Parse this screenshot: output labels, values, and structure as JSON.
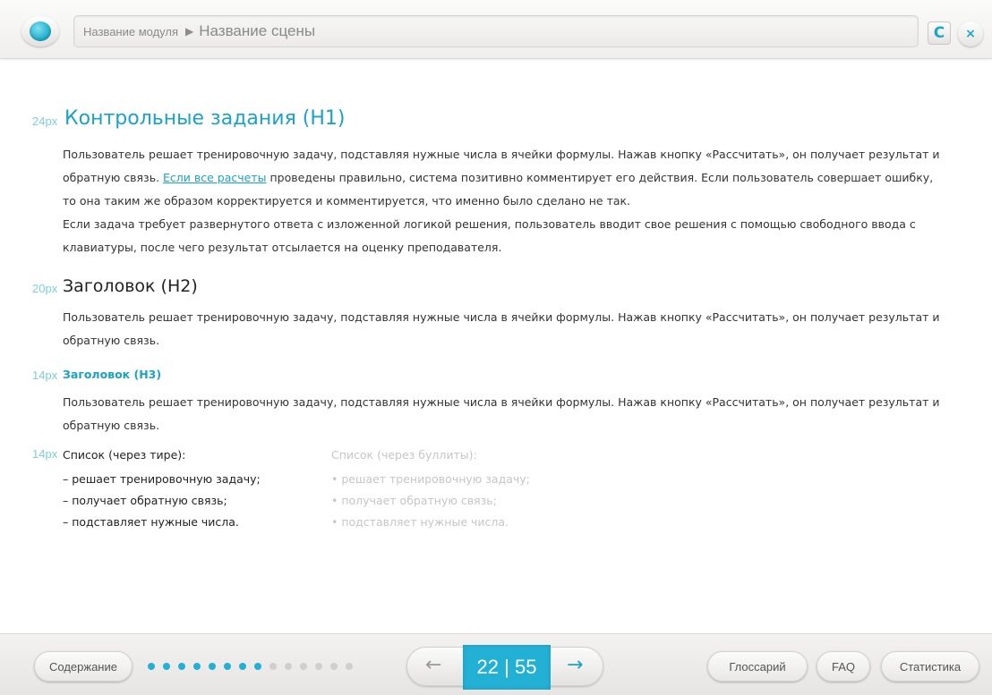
{
  "header": {
    "module_name": "Название модуля",
    "arrow": "▶",
    "scene_name": "Название сцены",
    "refresh_glyph": "C",
    "close_glyph": "×"
  },
  "content": {
    "h1": {
      "size": "24px",
      "text": "Контрольные задания (H1)"
    },
    "para1": {
      "before_link": "Пользователь решает тренировочную задачу, подставляя нужные числа в ячейки формулы. Нажав кнопку «Рассчитать», он получает результат и обратную связь. ",
      "link": "Если все расчеты",
      "after_link": " проведены правильно, система позитивно комментирует его действия. Если пользователь совершает ошибку, то она таким же образом корректируется и комментируется, что именно было сделано не так."
    },
    "para2": "Если задача требует развернутого ответа с изложенной логикой решения, пользователь вводит свое решения с помощью свободного ввода с клавиатуры, после чего результат отсылается на оценку преподавателя.",
    "h2": {
      "size": "20px",
      "text": "Заголовок (H2)"
    },
    "para3": "Пользователь решает тренировочную задачу, подставляя нужные числа в ячейки формулы. Нажав кнопку «Рассчитать», он получает результат и обратную связь.",
    "h3": {
      "size": "14px",
      "text": "Заголовок (H3)"
    },
    "para4": "Пользователь решает тренировочную задачу, подставляя нужные числа в ячейки формулы. Нажав кнопку «Рассчитать», он получает результат и обратную связь.",
    "list_size": "14px",
    "dash_list": {
      "title": "Список (через тире):",
      "items": [
        "– решает тренировочную задачу;",
        "– получает обратную связь;",
        "– подставляет нужные числа."
      ]
    },
    "bullet_list": {
      "title": "Список (через буллиты):",
      "items": [
        "• решает тренировочную задачу;",
        "• получает обратную связь;",
        "• подставляет нужные числа."
      ]
    }
  },
  "footer": {
    "contents_label": "Содержание",
    "progress": {
      "completed": 8,
      "total": 14
    },
    "prev_glyph": "←",
    "next_glyph": "→",
    "page_counter": "22 | 55",
    "glossary_label": "Глоссарий",
    "faq_label": "FAQ",
    "stats_label": "Статистика"
  },
  "colors": {
    "accent": "#1aa3c6",
    "dot_done": "#22b0d4",
    "dot_todo": "#cfcfcf"
  }
}
